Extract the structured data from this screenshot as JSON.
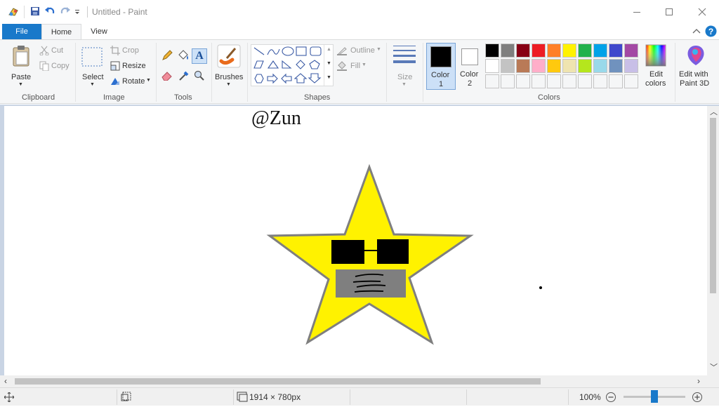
{
  "window": {
    "title": "Untitled - Paint"
  },
  "tabs": {
    "file": "File",
    "home": "Home",
    "view": "View"
  },
  "clipboard": {
    "paste": "Paste",
    "cut": "Cut",
    "copy": "Copy",
    "group": "Clipboard"
  },
  "image": {
    "select": "Select",
    "crop": "Crop",
    "resize": "Resize",
    "rotate": "Rotate",
    "group": "Image"
  },
  "tools": {
    "group": "Tools",
    "text_glyph": "A"
  },
  "brushes": {
    "label": "Brushes"
  },
  "shapes": {
    "outline": "Outline",
    "fill": "Fill",
    "group": "Shapes"
  },
  "size": {
    "label": "Size"
  },
  "color1": {
    "line1": "Color",
    "line2": "1",
    "value": "#000000"
  },
  "color2": {
    "line1": "Color",
    "line2": "2",
    "value": "#ffffff"
  },
  "colors": {
    "group": "Colors",
    "row1": [
      "#000000",
      "#7f7f7f",
      "#880015",
      "#ed1c24",
      "#ff7f27",
      "#fff200",
      "#22b14c",
      "#00a2e8",
      "#3f48cc",
      "#a349a4"
    ],
    "row2": [
      "#ffffff",
      "#c3c3c3",
      "#b97a57",
      "#ffaec9",
      "#ffc90e",
      "#efe4b0",
      "#b5e61d",
      "#99d9ea",
      "#7092be",
      "#c8bfe7"
    ],
    "row3": [
      "#f5f6f7",
      "#f5f6f7",
      "#f5f6f7",
      "#f5f6f7",
      "#f5f6f7",
      "#f5f6f7",
      "#f5f6f7",
      "#f5f6f7",
      "#f5f6f7",
      "#f5f6f7"
    ]
  },
  "edit_colors": {
    "line1": "Edit",
    "line2": "colors"
  },
  "paint3d": {
    "line1": "Edit with",
    "line2": "Paint 3D"
  },
  "canvas": {
    "text": "@Zun"
  },
  "status": {
    "dimensions": "1914 × 780px",
    "zoom": "100%",
    "zoom_level_fraction": 0.5
  }
}
